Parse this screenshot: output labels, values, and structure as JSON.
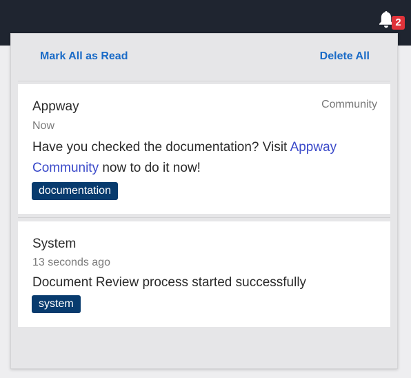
{
  "topbar": {
    "notification_badge": "2",
    "bell_icon": "bell-icon"
  },
  "panel": {
    "mark_all_label": "Mark All as Read",
    "delete_all_label": "Delete All"
  },
  "notifications": [
    {
      "title": "Appway",
      "source": "Community",
      "time": "Now",
      "message_before": "Have you checked the documentation? Visit ",
      "message_link": "Appway Community",
      "message_after": " now to do it now!",
      "tag": "documentation"
    },
    {
      "title": "System",
      "source": "",
      "time": "13 seconds ago",
      "message_before": "Document Review process started successfully",
      "message_link": "",
      "message_after": "",
      "tag": "system"
    }
  ],
  "colors": {
    "topbar": "#1f2530",
    "accent_link": "#1a6bc7",
    "inline_link": "#3a49c9",
    "tag_bg": "#083b6e",
    "badge": "#e0333a"
  }
}
